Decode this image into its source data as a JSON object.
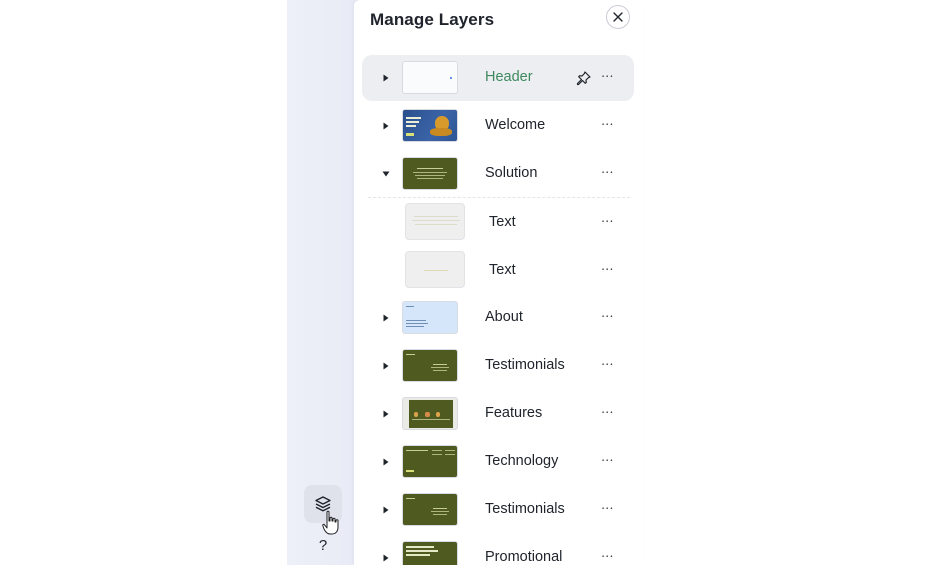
{
  "panel": {
    "title": "Manage Layers"
  },
  "layers": [
    {
      "label": "Header",
      "selected": true,
      "pinned": true
    },
    {
      "label": "Welcome"
    },
    {
      "label": "Solution",
      "expanded": true
    },
    {
      "label": "Text",
      "child": true
    },
    {
      "label": "Text",
      "child": true
    },
    {
      "label": "About"
    },
    {
      "label": "Testimonials"
    },
    {
      "label": "Features"
    },
    {
      "label": "Technology"
    },
    {
      "label": "Testimonials"
    },
    {
      "label": "Promotional"
    }
  ],
  "more_glyph": "···",
  "help": {
    "label": "?"
  },
  "icons": {
    "expand": "triangle-right-icon",
    "collapse": "triangle-down-icon",
    "pin": "pin-icon",
    "more": "more-horizontal-icon",
    "close": "close-icon",
    "layers": "layers-icon",
    "cursor": "hand-cursor-icon"
  },
  "colors": {
    "accent_text": "#3e8a5f",
    "section_green": "#4f5a21",
    "selected_row": "#eceef1"
  }
}
